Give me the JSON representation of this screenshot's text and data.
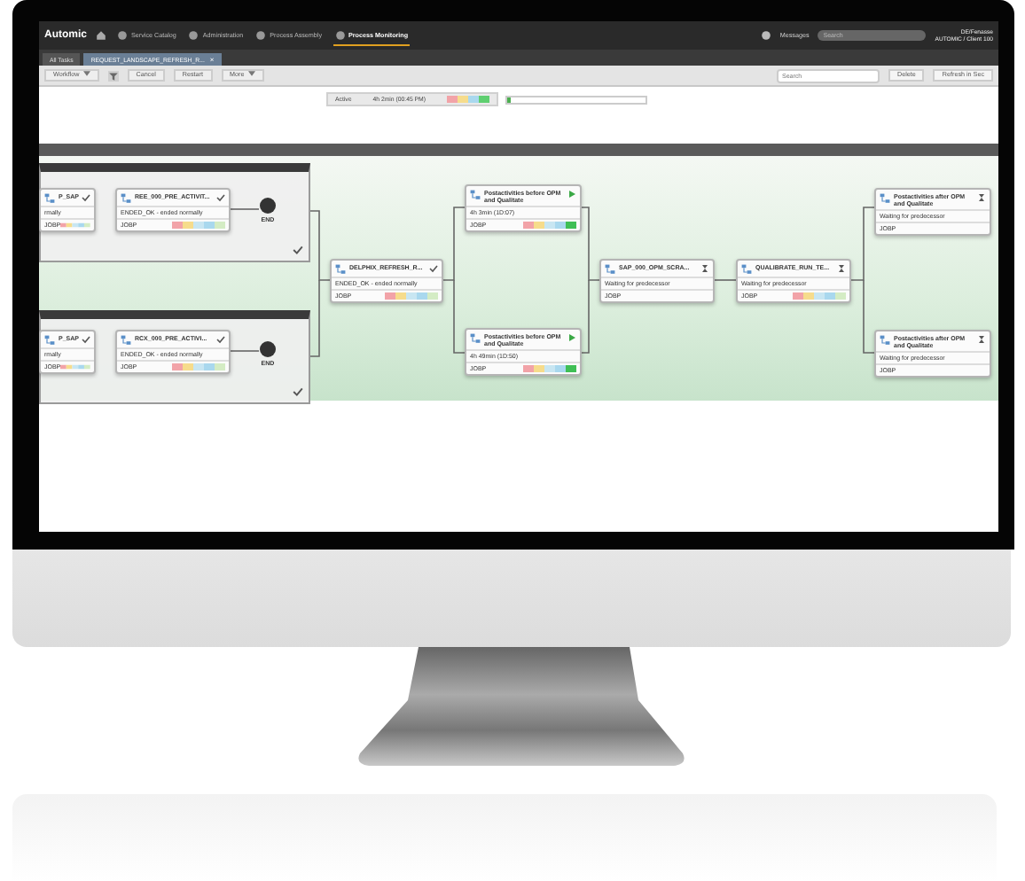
{
  "nav": {
    "brand": "Automic",
    "items": [
      {
        "label": "Service Catalog",
        "selected": false
      },
      {
        "label": "Administration",
        "selected": false
      },
      {
        "label": "Process Assembly",
        "selected": false
      },
      {
        "label": "Process Monitoring",
        "selected": true
      }
    ],
    "messages": "Messages",
    "search_placeholder": "Search",
    "user": [
      "DE/Fenasse",
      "AUTOMIC / Client 100"
    ]
  },
  "tabs": [
    {
      "label": "All Tasks",
      "selected": false
    },
    {
      "label": "REQUEST_LANDSCAPE_REFRESH_R...",
      "selected": true,
      "close": "×"
    }
  ],
  "toolbar": {
    "workflow": "Workflow",
    "cancel": "Cancel",
    "restart": "Restart",
    "more": "More",
    "search_placeholder": "Search",
    "delete": "Delete",
    "refresh": "Refresh in Sec"
  },
  "info": {
    "status": "Active",
    "duration": "4h 2min (00:45 PM)",
    "level": 0.03
  },
  "nodes": [
    {
      "kind": "ended",
      "title": "P_SAP",
      "status": "rmally",
      "type": "JOBP",
      "bar": true
    },
    {
      "kind": "ended",
      "title": "REE_000_PRE_ACTIVIT...",
      "status": "ENDED_OK - ended normally",
      "type": "JOBP",
      "bar": true
    },
    {
      "kind": "end",
      "label": "END"
    },
    {
      "kind": "ended",
      "title": "P_SAP",
      "status": "rmally",
      "type": "JOBP",
      "bar": true
    },
    {
      "kind": "ended",
      "title": "RCX_000_PRE_ACTIVI...",
      "status": "ENDED_OK - ended normally",
      "type": "JOBP",
      "bar": true
    },
    {
      "kind": "end",
      "label": "END"
    },
    {
      "kind": "ended",
      "title": "DELPHIX_REFRESH_R...",
      "status": "ENDED_OK - ended normally",
      "type": "JOBP",
      "bar": true
    },
    {
      "kind": "running",
      "title": "Postactivities before OPM and Qualitate",
      "status": "4h 3min (1D:07)",
      "type": "JOBP",
      "bar": true
    },
    {
      "kind": "waiting",
      "title": "SAP_000_OPM_SCRA...",
      "status": "Waiting for predecessor",
      "type": "JOBP",
      "bar": false
    },
    {
      "kind": "running",
      "title": "Postactivities before OPM and Qualitate",
      "status": "4h 49min (1D:50)",
      "type": "JOBP",
      "bar": true
    },
    {
      "kind": "waiting",
      "title": "QUALIBRATE_RUN_TE...",
      "status": "Waiting for predecessor",
      "type": "JOBP",
      "bar": true
    },
    {
      "kind": "waiting",
      "title": "Postactivities after OPM and Qualitate",
      "status": "Waiting for predecessor",
      "type": "JOBP",
      "bar": false
    },
    {
      "kind": "waiting",
      "title": "Postactivities after OPM and Qualitate",
      "status": "Waiting for predecessor",
      "type": "JOBP",
      "bar": false
    }
  ]
}
